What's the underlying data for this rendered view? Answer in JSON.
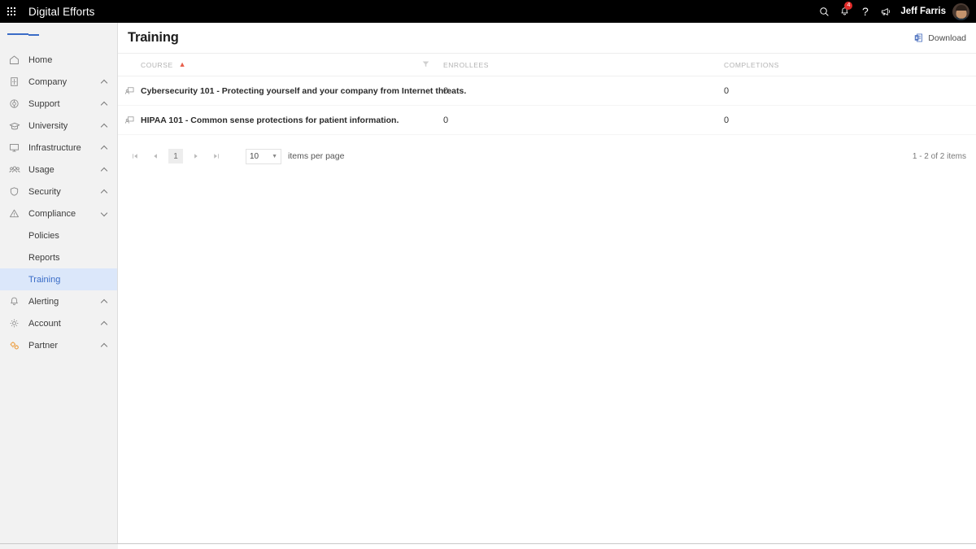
{
  "topbar": {
    "waffle_icon": "apps-grid-icon",
    "brand": "Digital Efforts",
    "search_icon": "search-icon",
    "notifications_icon": "bell-icon",
    "notifications_badge": "4",
    "help_icon": "question-mark-icon",
    "announcements_icon": "megaphone-icon",
    "user_name": "Jeff Farris",
    "avatar": "user-avatar"
  },
  "sidebar": {
    "toggle_icon": "hamburger-menu-icon",
    "items": [
      {
        "label": "Home",
        "icon": "home-icon",
        "chevron": "none"
      },
      {
        "label": "Company",
        "icon": "building-icon",
        "chevron": "up"
      },
      {
        "label": "Support",
        "icon": "support-icon",
        "chevron": "up"
      },
      {
        "label": "University",
        "icon": "graduation-cap-icon",
        "chevron": "up"
      },
      {
        "label": "Infrastructure",
        "icon": "monitor-icon",
        "chevron": "up"
      },
      {
        "label": "Usage",
        "icon": "people-icon",
        "chevron": "up"
      },
      {
        "label": "Security",
        "icon": "shield-icon",
        "chevron": "up"
      },
      {
        "label": "Compliance",
        "icon": "warning-triangle-icon",
        "chevron": "down"
      }
    ],
    "subitems": [
      {
        "label": "Policies",
        "active": false
      },
      {
        "label": "Reports",
        "active": false
      },
      {
        "label": "Training",
        "active": true
      }
    ],
    "items_after": [
      {
        "label": "Alerting",
        "icon": "bell-icon",
        "chevron": "up"
      },
      {
        "label": "Account",
        "icon": "gear-icon",
        "chevron": "up"
      },
      {
        "label": "Partner",
        "icon": "partner-gears-icon",
        "chevron": "up"
      }
    ],
    "active_color": "#3a6cc7",
    "active_bg": "#dbe7fa"
  },
  "page": {
    "title": "Training",
    "download_label": "Download",
    "download_icon": "excel-export-icon"
  },
  "table": {
    "columns": [
      "COURSE",
      "ENROLLEES",
      "COMPLETIONS"
    ],
    "sort_column": "COURSE",
    "sort_direction": "ascending",
    "sort_arrow": "▲",
    "sort_color": "#e8604c",
    "filter_icon": "filter-funnel-icon",
    "row_icon": "training-presentation-icon",
    "rows": [
      {
        "course": "Cybersecurity 101 - Protecting yourself and your company from Internet threats.",
        "enrollees": "0",
        "completions": "0"
      },
      {
        "course": "HIPAA 101 - Common sense protections for patient information.",
        "enrollees": "0",
        "completions": "0"
      }
    ]
  },
  "pager": {
    "first_icon": "first-page-icon",
    "prev_icon": "previous-page-icon",
    "current_page": "1",
    "next_icon": "next-page-icon",
    "last_icon": "last-page-icon",
    "page_size": "10",
    "page_size_caret": "▼",
    "per_page_label": "items per page",
    "count_label": "1 - 2 of 2 items"
  }
}
